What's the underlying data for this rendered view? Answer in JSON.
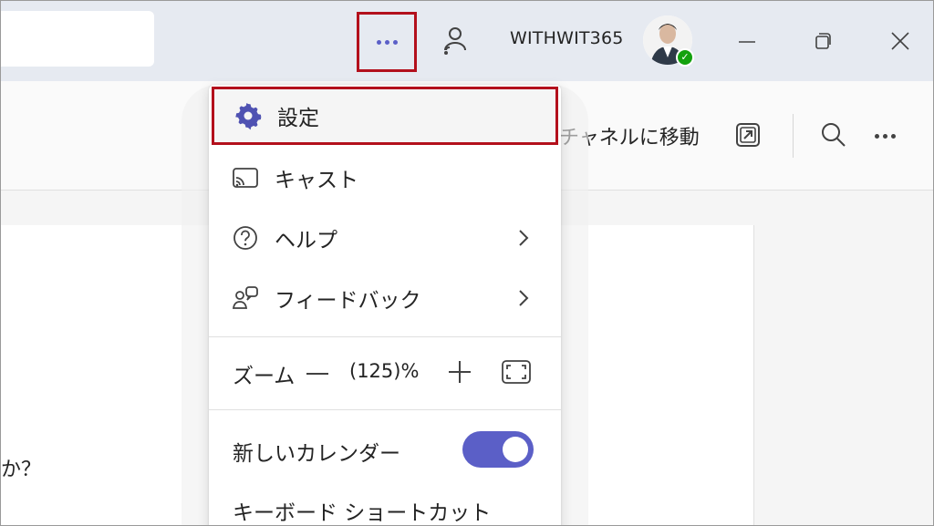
{
  "titlebar": {
    "account_name": "WITHWIT365",
    "colors": {
      "accent": "#5b5fc7",
      "highlight_border": "#b3101c",
      "status_available": "#13a10e"
    },
    "icons": [
      "more-horizontal-icon",
      "notification-bell-icon",
      "minimize-icon",
      "restore-icon",
      "close-icon"
    ]
  },
  "header": {
    "goto_channel_label": "チャネルに移動"
  },
  "content": {
    "question_fragment": "か？"
  },
  "menu": {
    "items": [
      {
        "label": "設定",
        "icon": "gear-icon"
      },
      {
        "label": "キャスト",
        "icon": "cast-icon"
      },
      {
        "label": "ヘルプ",
        "icon": "help-circle-icon",
        "has_submenu": true
      },
      {
        "label": "フィードバック",
        "icon": "feedback-icon",
        "has_submenu": true
      }
    ],
    "zoom": {
      "label": "ズーム",
      "value": "(125)%"
    },
    "new_calendar": {
      "label": "新しいカレンダー",
      "enabled": true
    },
    "keyboard_shortcut_label": "キーボード ショートカット"
  }
}
